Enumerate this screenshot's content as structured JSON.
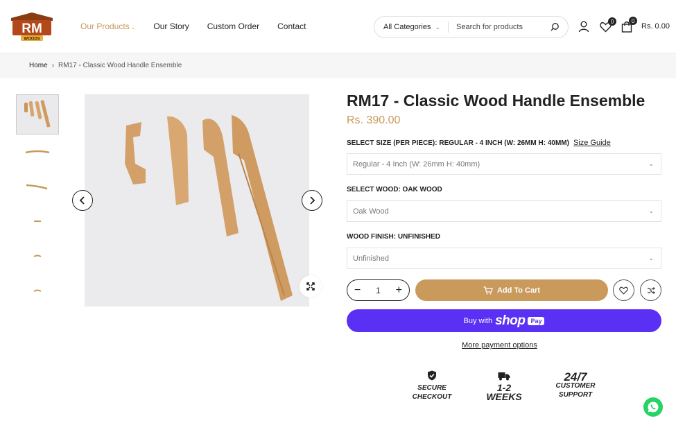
{
  "brand": {
    "logo_text": "RM",
    "logo_subtext": "WOODS",
    "accent": "#c99a5b",
    "pay_color": "#5a31f4"
  },
  "nav": {
    "items": [
      "Our Products",
      "Our Story",
      "Custom Order",
      "Contact"
    ]
  },
  "search": {
    "category": "All Categories",
    "placeholder": "Search for products"
  },
  "header": {
    "wishlist_count": "0",
    "cart_count": "0",
    "cart_total": "Rs. 0.00"
  },
  "breadcrumb": {
    "home": "Home",
    "separator": "›",
    "current": "RM17 - Classic Wood Handle Ensemble"
  },
  "product": {
    "title": "RM17 - Classic Wood Handle Ensemble",
    "price": "Rs. 390.00",
    "size_label": "SELECT SIZE (PER PIECE): REGULAR - 4 INCH (W: 26MM H: 40MM)",
    "size_guide": "Size Guide",
    "size_value": "Regular - 4 Inch (W: 26mm H: 40mm)",
    "wood_label": "SELECT WOOD: OAK WOOD",
    "wood_value": "Oak Wood",
    "finish_label": "WOOD FINISH: UNFINISHED",
    "finish_value": "Unfinished",
    "quantity": "1",
    "add_to_cart": "Add To Cart",
    "buy_with": "Buy with",
    "shop_word": "shop",
    "pay_word": "Pay",
    "more_payment": "More payment options"
  },
  "features": [
    {
      "line1": "SECURE",
      "line2": "CHECKOUT",
      "icon": "shield-check-icon"
    },
    {
      "line1": "1-2",
      "line2": "WEEKS",
      "icon": "truck-icon"
    },
    {
      "line1": "24/7",
      "line2": "CUSTOMER",
      "line3": "SUPPORT",
      "icon": "none"
    }
  ]
}
